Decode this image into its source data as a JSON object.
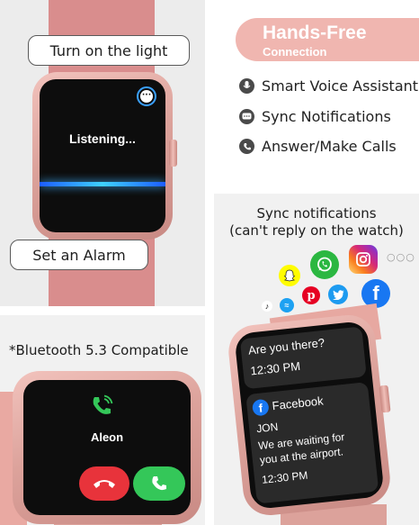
{
  "top_left": {
    "bubble_top": "Turn on the light",
    "bubble_bottom": "Set an Alarm",
    "screen_text": "Listening..."
  },
  "top_right": {
    "heading_line1": "Hands-Free",
    "heading_line2": "Connection",
    "features": [
      {
        "icon": "microphone-icon",
        "label": "Smart Voice Assistant"
      },
      {
        "icon": "chat-icon",
        "label": "Sync Notifications"
      },
      {
        "icon": "phone-icon",
        "label": "Answer/Make Calls"
      }
    ]
  },
  "bottom_left": {
    "caption": "*Bluetooth 5.3 Compatible",
    "caller_name": "Aleon"
  },
  "bottom_right": {
    "caption_line1": "Sync notifications",
    "caption_line2": "(can't reply on the watch)",
    "msg1_line1": "Are you there?",
    "msg1_time": "12:30 PM",
    "msg2_app": "Facebook",
    "msg2_sender": "JON",
    "msg2_line1": "We are waiting for",
    "msg2_line2": "you at the airport.",
    "msg2_time": "12:30 PM",
    "more_dots": "○○○"
  },
  "colors": {
    "pink": "#f0b6b0",
    "watch_rose": "#dca29b",
    "whatsapp": "#2bb741",
    "facebook": "#1877f2",
    "twitter": "#1d9bf0",
    "pinterest": "#e60023",
    "snapchat": "#fffc00",
    "decline": "#e8333b",
    "accept": "#34c759"
  }
}
